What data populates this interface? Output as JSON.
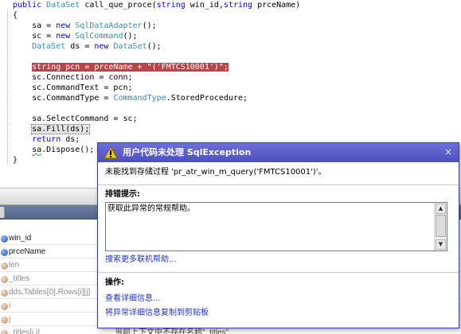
{
  "editor": {
    "lines": [
      {
        "parts": [
          {
            "t": "public",
            "c": "kw"
          },
          {
            "t": " "
          },
          {
            "t": "DataSet",
            "c": "ty"
          },
          {
            "t": " call_que_proce("
          },
          {
            "t": "string",
            "c": "kw"
          },
          {
            "t": " win_id,"
          },
          {
            "t": "string",
            "c": "kw"
          },
          {
            "t": " prceName)"
          }
        ]
      },
      {
        "parts": [
          {
            "t": "{"
          }
        ]
      },
      {
        "parts": [
          {
            "t": "    sa = "
          },
          {
            "t": "new",
            "c": "kw"
          },
          {
            "t": " "
          },
          {
            "t": "SqlDataAdapter",
            "c": "ty"
          },
          {
            "t": "();"
          }
        ]
      },
      {
        "parts": [
          {
            "t": "    sc = "
          },
          {
            "t": "new",
            "c": "kw"
          },
          {
            "t": " "
          },
          {
            "t": "SqlCommand",
            "c": "ty"
          },
          {
            "t": "();"
          }
        ]
      },
      {
        "parts": [
          {
            "t": "    "
          },
          {
            "t": "DataSet",
            "c": "ty"
          },
          {
            "t": " ds = "
          },
          {
            "t": "new",
            "c": "kw"
          },
          {
            "t": " "
          },
          {
            "t": "DataSet",
            "c": "ty"
          },
          {
            "t": "();"
          }
        ]
      },
      {
        "parts": [
          {
            "t": ""
          }
        ]
      },
      {
        "parts": [
          {
            "t": "    "
          },
          {
            "t": "string pcn = prceName + \"('FMTCS10001')\";",
            "c": "hl-line"
          }
        ]
      },
      {
        "parts": [
          {
            "t": "    sc.Connection = conn;"
          }
        ]
      },
      {
        "parts": [
          {
            "t": "    sc.CommandText = pcn;"
          }
        ]
      },
      {
        "parts": [
          {
            "t": "    sc.CommandType = "
          },
          {
            "t": "CommandType",
            "c": "ty"
          },
          {
            "t": ".StoredProcedure;"
          }
        ]
      },
      {
        "parts": [
          {
            "t": ""
          }
        ]
      },
      {
        "parts": [
          {
            "t": "    sa.SelectCommand = sc;"
          }
        ]
      },
      {
        "parts": [
          {
            "t": "    "
          },
          {
            "t": "sa.Fill(ds);",
            "c": "cur-stmt"
          }
        ]
      },
      {
        "parts": [
          {
            "t": "    "
          },
          {
            "t": "return",
            "c": "kw"
          },
          {
            "t": " ds;"
          }
        ]
      },
      {
        "parts": [
          {
            "t": "    "
          },
          {
            "t": "sa",
            "c": "squiggle"
          },
          {
            "t": ".Dispose();"
          }
        ]
      },
      {
        "parts": [
          {
            "t": "}"
          }
        ]
      }
    ]
  },
  "locals": {
    "rows": [
      {
        "name": "win_id",
        "value": "",
        "icon": "icon-blue",
        "expander": ""
      },
      {
        "name": "prceName",
        "value": "",
        "icon": "icon-blue",
        "expander": ""
      },
      {
        "name": "len",
        "value": "",
        "icon": "icon-tan",
        "expander": "",
        "dim": true
      },
      {
        "name": "_titles",
        "value": "",
        "icon": "icon-tan",
        "expander": "+",
        "dim": true
      },
      {
        "name": "dds.Tables[0].Rows[i][j]",
        "value": "",
        "icon": "icon-tan",
        "expander": "",
        "dim": true
      },
      {
        "name": "i",
        "value": "",
        "icon": "icon-tan",
        "expander": "",
        "dim": true
      },
      {
        "name": "j",
        "value": "",
        "icon": "icon-tan",
        "expander": "",
        "dim": true
      },
      {
        "name": "_titles[i,j]",
        "value": "当前上下文中不存在名称\"_titles\"",
        "icon": "icon-tan",
        "expander": "",
        "dim": true
      }
    ]
  },
  "popup": {
    "title": "用户代码未处理 SqlException",
    "message": "未能找到存储过程 'pr_atr_win_m_query('FMTCS10001')'。",
    "tips_heading": "排错提示:",
    "tips_text": "获取此异常的常规帮助。",
    "search_link": "搜索更多联机帮助...",
    "actions_heading": "操作:",
    "action_details": "查看详细信息...",
    "action_copy": "将异常详细信息复制到剪贴板",
    "close_glyph": "×",
    "title_color": "#5556c8"
  }
}
